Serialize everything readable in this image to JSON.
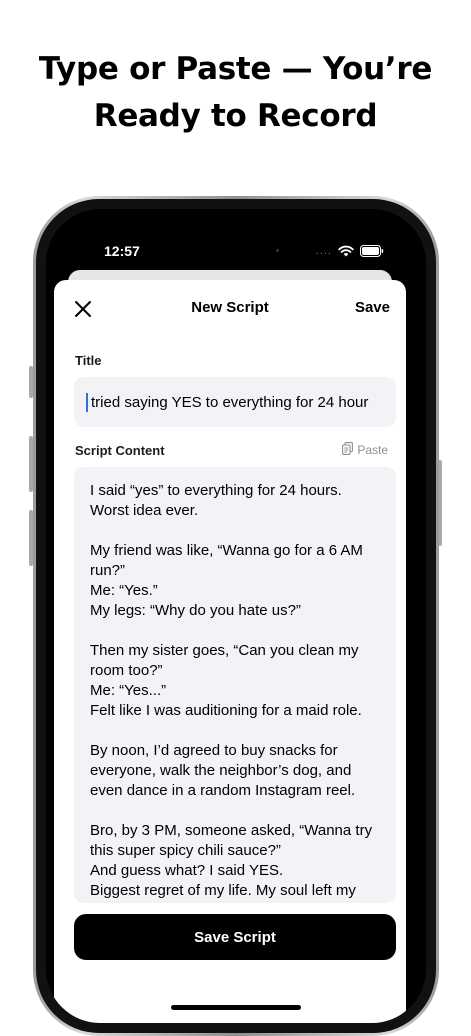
{
  "headline": {
    "line1": "Type or Paste — You’re",
    "line2": "Ready to Record"
  },
  "status_bar": {
    "time": "12:57",
    "signal": "....",
    "icons": [
      "wifi-icon",
      "battery-icon"
    ]
  },
  "nav": {
    "close_icon": "close-icon",
    "title": "New Script",
    "save_label": "Save"
  },
  "form": {
    "title_label": "Title",
    "title_value": "tried saying YES to everything for 24 hour",
    "content_label": "Script Content",
    "paste_label": "Paste",
    "paste_icon": "clipboard-icon",
    "content_lines": [
      "I said “yes” to everything for 24 hours.",
      "Worst idea ever.",
      "",
      "My friend was like, “Wanna go for a 6 AM",
      "run?”",
      "Me: “Yes.”",
      "My legs: “Why do you hate us?”",
      "",
      "Then my sister goes, “Can you clean my",
      "room too?”",
      "Me: “Yes...”",
      "Felt like I was auditioning for a maid role.",
      "",
      "By noon, I’d agreed to buy snacks for",
      "everyone, walk the neighbor’s dog, and",
      "even dance in a random Instagram reel.",
      "",
      "Bro, by 3 PM, someone asked, “Wanna try",
      "this super spicy chili sauce?”",
      "And guess what? I said YES.",
      "Biggest regret of my life. My soul left my"
    ],
    "save_button_label": "Save Script"
  },
  "colors": {
    "accent": "#000000",
    "field_bg": "#f2f2f7",
    "caret": "#2f6fdf",
    "secondary_text": "#8e8e93"
  }
}
